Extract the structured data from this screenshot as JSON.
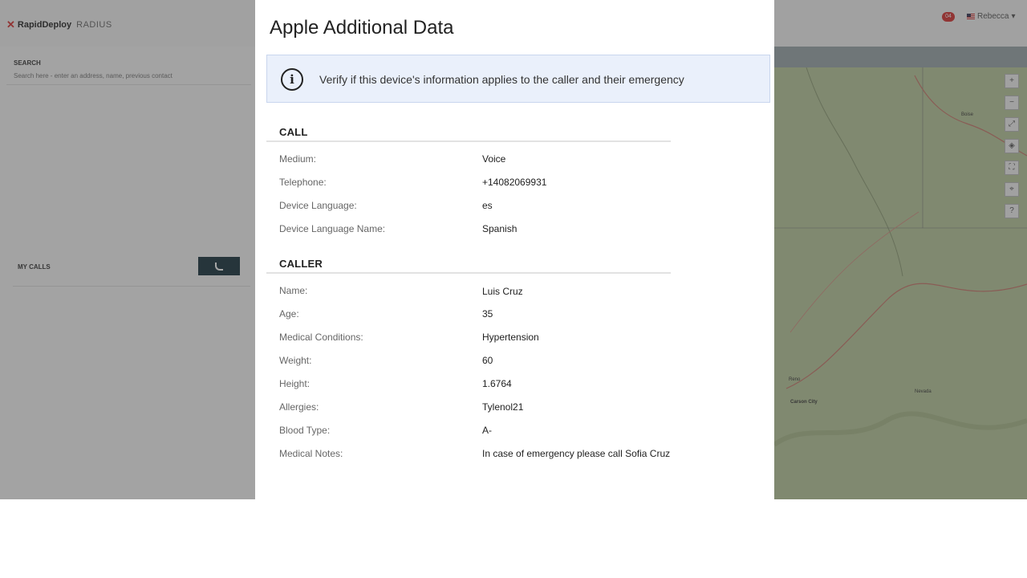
{
  "app": {
    "brand": "RapidDeploy",
    "product": "RADIUS",
    "notification_count": "04",
    "user_name": "Rebecca"
  },
  "sidebar": {
    "search_label": "SEARCH",
    "search_placeholder": "Search here - enter an address, name, previous contact",
    "calls_title": "MY CALLS"
  },
  "modal": {
    "title": "Apple Additional Data",
    "info_text": "Verify if this device's information applies to the caller and their emergency",
    "sections": [
      {
        "title": "CALL",
        "fields": [
          {
            "label": "Medium:",
            "value": "Voice"
          },
          {
            "label": "Telephone:",
            "value": "+14082069931"
          },
          {
            "label": "Device Language:",
            "value": "es"
          },
          {
            "label": "Device Language Name:",
            "value": "Spanish"
          }
        ]
      },
      {
        "title": "CALLER",
        "fields": [
          {
            "label": "Name:",
            "value": "Luis Cruz"
          },
          {
            "label": "Age:",
            "value": "35"
          },
          {
            "label": "Medical Conditions:",
            "value": "Hypertension"
          },
          {
            "label": "Weight:",
            "value": "60"
          },
          {
            "label": "Height:",
            "value": "1.6764"
          },
          {
            "label": "Allergies:",
            "value": "Tylenol21"
          },
          {
            "label": "Blood Type:",
            "value": "A-"
          },
          {
            "label": "Medical Notes:",
            "value": "In case of emergency please call Sofia Cruz"
          }
        ]
      }
    ]
  },
  "map": {
    "labels": [
      "Boise",
      "Reno",
      "Carson City",
      "Nevada"
    ]
  },
  "colors": {
    "accent_dark": "#14303b",
    "alert_red": "#d8302f",
    "banner_bg": "#eaf0fb"
  }
}
